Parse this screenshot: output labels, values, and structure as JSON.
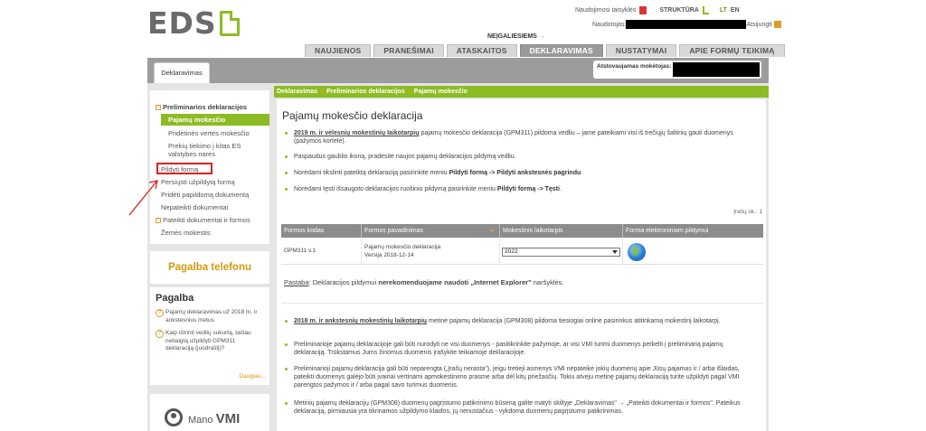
{
  "header": {
    "logo_text": "EDS",
    "links": {
      "rules": "Naudojimosi taisyklės",
      "structure": "STRUKTŪRA",
      "lt": "LT",
      "en": "EN"
    },
    "user_label": "Naudotojas:",
    "logout": "Atsijungti",
    "neigaliesiems": "NEĮGALIESIEMS",
    "neigaliesiems_arrow": "→"
  },
  "tabs": [
    {
      "label": "NAUJIENOS"
    },
    {
      "label": "PRANEŠIMAI"
    },
    {
      "label": "ATASKAITOS"
    },
    {
      "label": "DEKLARAVIMAS"
    },
    {
      "label": "NUSTATYMAI"
    },
    {
      "label": "APIE FORMŲ TEIKIMĄ"
    }
  ],
  "subtab": "Deklaravimas",
  "represented_label": "Atstovaujamas mokėtojas:",
  "sidebar": {
    "section1": "Preliminarios deklaracijos",
    "items": [
      "Pajamų mokesčio",
      "Pridėtinės vertės mokesčio",
      "Prekių tiekimo į kitas ES valstybes nares"
    ],
    "links": [
      "Pildyti formą",
      "Persiųsti užpildytą formą",
      "Pridėti papildomą dokumentą",
      "Nepateikti dokumentai"
    ],
    "section2": "Pateikti dokumentai ir formos",
    "zemes": "Žemės mokestis",
    "phone": "Pagalba telefonu",
    "help_title": "Pagalba",
    "help_items": [
      "Pajamų deklaravimas už 2018 m. ir ankstesnius metus",
      "Kaip ištrinti vedlių sukurtą, tačiau nebaigtą užpildyti GPM311 deklaraciją (juodraštį)?"
    ],
    "more": "Daugiau...",
    "mano_vmi_a": "Mano",
    "mano_vmi_b": "VMI"
  },
  "breadcrumb": [
    "Deklaravimas",
    "Preliminarios deklaracijos",
    "Pajamų mokesčio"
  ],
  "breadcrumb_sep": "»",
  "content": {
    "title": "Pajamų mokesčio deklaracija",
    "bullets": {
      "b1_u": "2019 m. ir vėlesnių mokestinių laikotarpių",
      "b1_rest": " pajamų mokesčio deklaracija (GPM311) pildoma vedliu – jame pateikiami visi iš trečiųjų šaltinių gauti duomenys (pažymos kortelė).",
      "b2": "Paspaudus gaublio ikoną, pradėsite naujos pajamų deklaracijos pildymą vedliu.",
      "b3_a": "Norėdami tikslinti pateiktą deklaraciją pasirinkite meniu ",
      "b3_b": "Pildyti formą -> Pildyti ankstesnės pagrindu",
      "b3_c": ".",
      "b4_a": "Norėdami tęsti išsaugoto deklaracijos ruošinio pildymą pasirinkite meniu ",
      "b4_b": "Pildyti formą -> Tęsti",
      "b4_c": "."
    },
    "records": "Įrašų sk.: 1",
    "table": {
      "headers": [
        "Formos kodas",
        "Formos pavadinimas",
        "Mokestinis laikotarpis",
        "Forma elektroniniam pildymui"
      ],
      "row": {
        "code": "GPM311 v.1",
        "name1": "Pajamų mokesčio deklaracija",
        "name2": "Versija 2018-12-14",
        "period": "2022"
      }
    },
    "note_label": "Pastaba",
    "note_a": ": Deklaracijos pildymui ",
    "note_b": "nerekomenduojame naudoti „Internet Explorer\"",
    "note_c": " naršyklės.",
    "older": {
      "b1_u": "2018 m. ir ankstesnių mokestinių laikotarpių",
      "b1_rest": " metinė pajamų deklaracija (GPM308) pildoma tiesiogiai online pasirinkus atitinkamą mokestinį laikotarpį.",
      "b2": "Preliminarioje pajamų deklaracijoje gali būti nurodyti ne visi duomenys - pasitikrinkite pažymoje, ar visi VMI turimi duomenys perkelti į preliminarią pajamų deklaraciją. Trūkstamus Jums žinomus duomenis įrašykite teikiamoje deklaracijoje.",
      "b3": "Preliminarioji pajamų deklaracija gali būti neparengta („Įrašų nerasta\"), jeigu tretieji asmenys VMI nepateikė jokių duomenų apie Jūsų pajamas ir / arba išlaidas, pateikti duomenys galėjo būti įvairiai vertinami apmokestinimo prasme arba dėl kitų priežasčių. Tokiu atveju metinę pajamų deklaraciją turite užpildyti pagal VMI parengtos pažymos ir / arba pagal savo turimus duomenis.",
      "b4": "Metinių pajamų deklaracijų (GPM308) duomenų pagrįstumo patikrinimo būseną galite matyti skiltyje „Deklaravimas\" → „Pateikti dokumentai ir formos\". Pateikus deklaraciją, pirmiausia yra tikrinamos užpildymo klaidos, jų nenustačius - vykdoma duomenų pagrįstumo patikrinimas."
    }
  }
}
